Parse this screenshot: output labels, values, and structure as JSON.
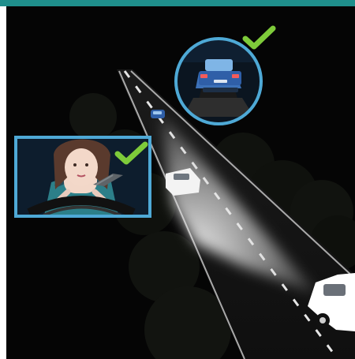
{
  "image": {
    "description_free": true,
    "accent_colors": {
      "header_bar": "#1f8f8c",
      "frame_border": "#4ea9d6",
      "check": "#7ecb3a",
      "beam": "#f2f2f2"
    },
    "icons": [
      "check-mark-icon",
      "check-mark-icon"
    ]
  }
}
